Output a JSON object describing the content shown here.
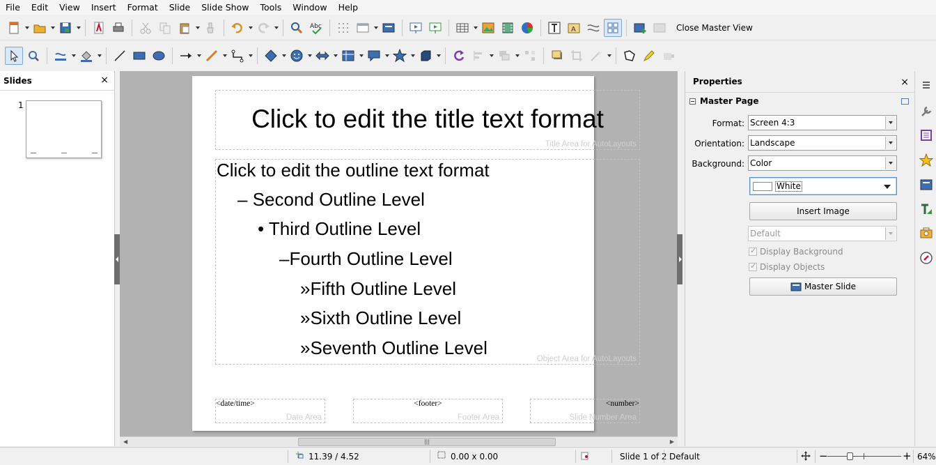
{
  "menu": [
    "File",
    "Edit",
    "View",
    "Insert",
    "Format",
    "Slide",
    "Slide Show",
    "Tools",
    "Window",
    "Help"
  ],
  "toolbar": {
    "close_master_view": "Close Master View"
  },
  "slides_pane": {
    "title": "Slides",
    "close": "×",
    "slide_number": "1"
  },
  "slide": {
    "title": "Click to edit the title text format",
    "title_area_label": "Title Area for AutoLayouts",
    "outline": [
      {
        "bullet": "",
        "text": "Click to edit the outline text format"
      },
      {
        "bullet": "–",
        "text": "Second Outline Level"
      },
      {
        "bullet": "•",
        "text": "Third Outline Level"
      },
      {
        "bullet": "–",
        "text": "Fourth Outline Level"
      },
      {
        "bullet": "»",
        "text": "Fifth Outline Level"
      },
      {
        "bullet": "»",
        "text": "Sixth Outline Level"
      },
      {
        "bullet": "»",
        "text": "Seventh Outline Level"
      }
    ],
    "object_area_label": "Object Area for AutoLayouts",
    "date_field": "<date/time>",
    "date_area_label": "Date Area",
    "footer_field": "<footer>",
    "footer_area_label": "Footer Area",
    "number_field": "<number>",
    "number_area_label": "Slide Number Area"
  },
  "properties": {
    "title": "Properties",
    "close": "×",
    "section": "Master Page",
    "format_label": "Format:",
    "format_value": "Screen 4:3",
    "orientation_label": "Orientation:",
    "orientation_value": "Landscape",
    "background_label": "Background:",
    "background_value": "Color",
    "color_value": "White",
    "insert_image": "Insert Image",
    "master_value": "Default",
    "display_background": "Display Background",
    "display_objects": "Display Objects",
    "master_slide": "Master Slide"
  },
  "status": {
    "position": "11.39 / 4.52",
    "size": "0.00 x 0.00",
    "slide": "Slide 1 of 2",
    "master": "Default",
    "zoom": "64%"
  },
  "colors": {
    "accent": "#4a7fbd",
    "canvas": "#b2b2b2"
  }
}
